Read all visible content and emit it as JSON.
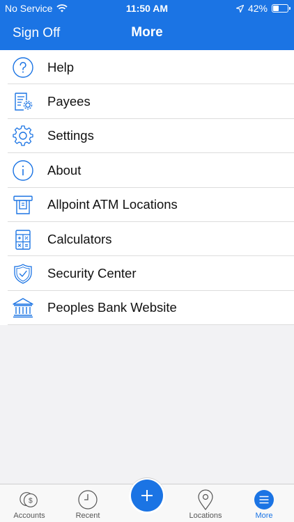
{
  "status_bar": {
    "carrier": "No Service",
    "time": "11:50 AM",
    "battery_percent": "42%",
    "battery_level": 0.42
  },
  "nav": {
    "left_button": "Sign Off",
    "title": "More"
  },
  "menu": {
    "items": [
      {
        "label": "Help",
        "icon": "help-circle-icon"
      },
      {
        "label": "Payees",
        "icon": "payees-document-gear-icon"
      },
      {
        "label": "Settings",
        "icon": "gear-icon"
      },
      {
        "label": "About",
        "icon": "info-circle-icon"
      },
      {
        "label": "Allpoint ATM Locations",
        "icon": "atm-icon"
      },
      {
        "label": "Calculators",
        "icon": "calculator-icon"
      },
      {
        "label": "Security Center",
        "icon": "shield-check-icon"
      },
      {
        "label": "Peoples Bank Website",
        "icon": "bank-building-icon"
      }
    ]
  },
  "tab_bar": {
    "tabs": [
      {
        "label": "Accounts",
        "icon": "coins-icon",
        "active": false
      },
      {
        "label": "Recent",
        "icon": "clock-icon",
        "active": false
      },
      {
        "label": "",
        "icon": "plus-icon",
        "active": false
      },
      {
        "label": "Locations",
        "icon": "location-pin-icon",
        "active": false
      },
      {
        "label": "More",
        "icon": "menu-lines-icon",
        "active": true
      }
    ]
  },
  "colors": {
    "accent": "#1b74e4",
    "icon_blue": "#1b74e4",
    "background": "#f2f2f4"
  }
}
